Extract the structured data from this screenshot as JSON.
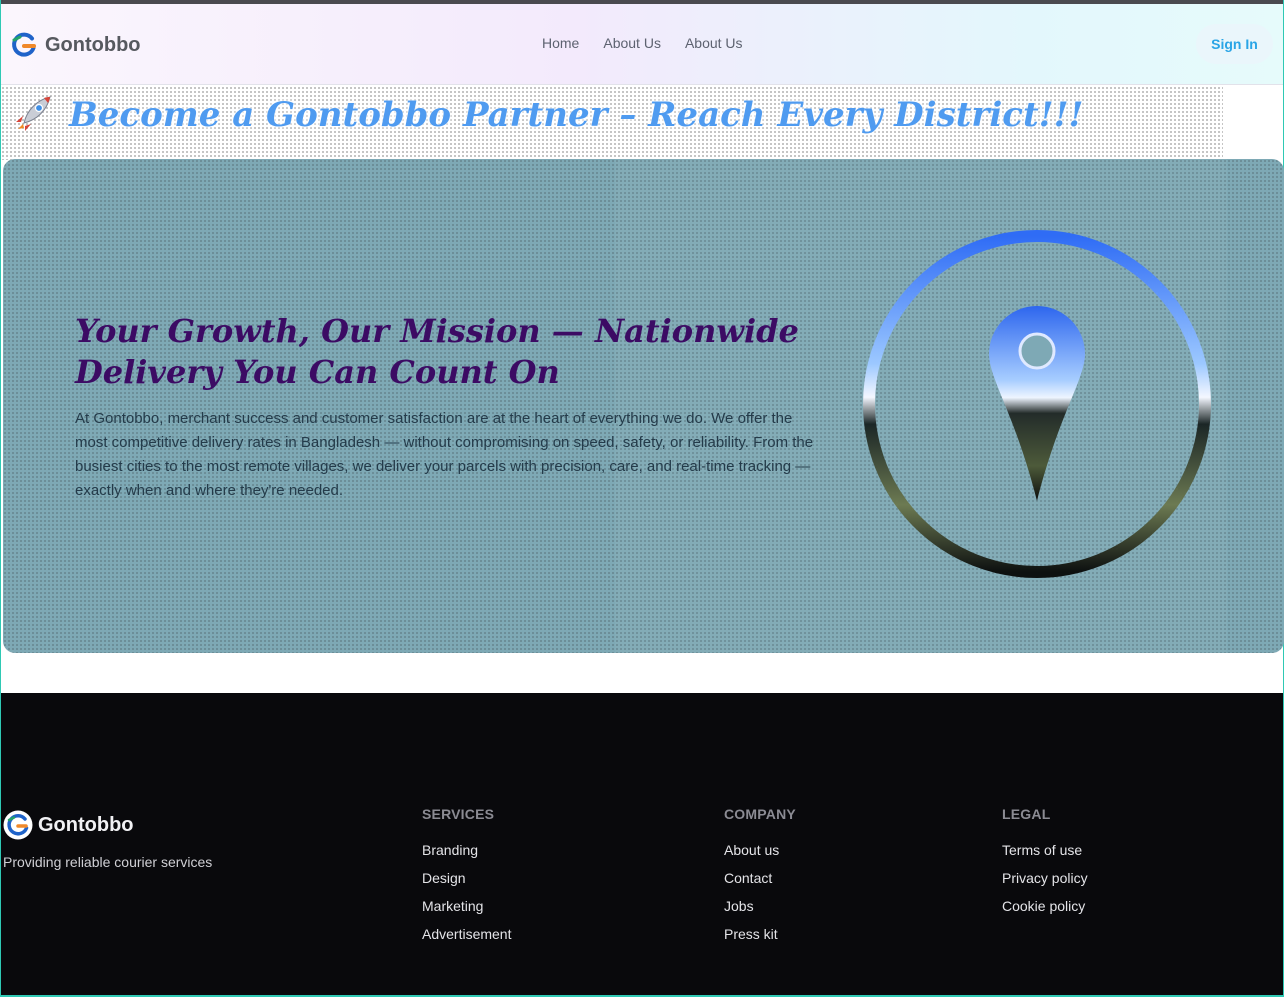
{
  "nav": {
    "brand": "Gontobbo",
    "links": [
      "Home",
      "About Us",
      "About Us"
    ],
    "signin": "Sign In"
  },
  "banner": {
    "title": "Become a Gontobbo Partner – Reach Every District!!!",
    "icon": "rocket-icon"
  },
  "hero": {
    "heading": "Your Growth, Our Mission — Nationwide Delivery You Can Count On",
    "body": "At Gontobbo, merchant success and customer satisfaction are at the heart of everything we do. We offer the most competitive delivery rates in Bangladesh — without compromising on speed, safety, or reliability. From the busiest cities to the most remote villages, we deliver your parcels with precision, care, and real-time tracking — exactly when and where they're needed.",
    "image": "location-pin-icon"
  },
  "footer": {
    "brand": "Gontobbo",
    "tagline": "Providing reliable courier services",
    "columns": [
      {
        "title": "SERVICES",
        "items": [
          "Branding",
          "Design",
          "Marketing",
          "Advertisement"
        ]
      },
      {
        "title": "COMPANY",
        "items": [
          "About us",
          "Contact",
          "Jobs",
          "Press kit"
        ]
      },
      {
        "title": "LEGAL",
        "items": [
          "Terms of use",
          "Privacy policy",
          "Cookie policy"
        ]
      }
    ]
  },
  "colors": {
    "brand_text": "#56595f",
    "banner_title": "#4f9bf0",
    "hero_bg": "#7ea9b5",
    "hero_heading": "#3c0b64",
    "signin_text": "#2aa5e6",
    "footer_bg": "#09090c"
  }
}
